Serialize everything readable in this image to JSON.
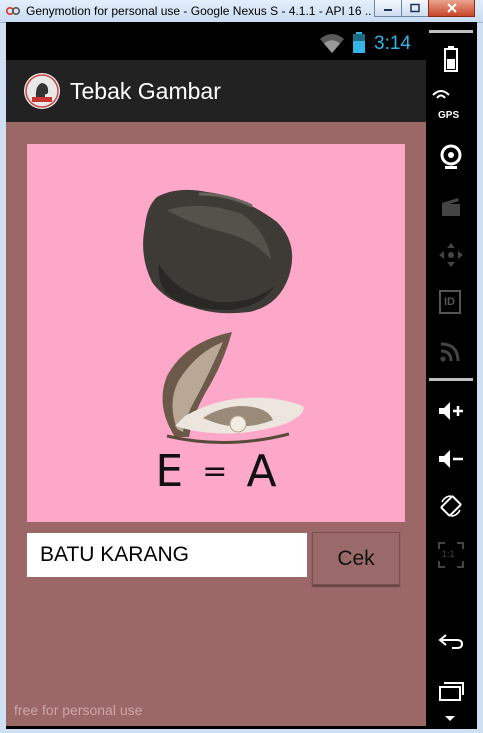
{
  "window": {
    "title": "Genymotion for personal use - Google Nexus S - 4.1.1 - API 16 ..."
  },
  "status_bar": {
    "time": "3:14",
    "accent_color": "#33b5e5"
  },
  "action_bar": {
    "title": "Tebak Gambar"
  },
  "puzzle": {
    "equation_left": "E",
    "equation_sign": "=",
    "equation_right": "A",
    "background_color": "#fda7c9",
    "images": [
      "rock",
      "oyster-with-pearl"
    ]
  },
  "answer": {
    "value": "BATU KARANG"
  },
  "check_button": {
    "label": "Cek"
  },
  "watermark": "free for personal use",
  "side_panel": {
    "gps_label": "GPS",
    "id_label": "ID",
    "ratio_label": "1:1",
    "icons": [
      "battery-icon",
      "gps-icon",
      "camera-icon",
      "capture-icon",
      "dpad-icon",
      "id-icon",
      "cast-icon",
      "volume-up-icon",
      "volume-down-icon",
      "rotate-icon",
      "scale-icon",
      "back-icon",
      "recent-apps-icon"
    ]
  }
}
